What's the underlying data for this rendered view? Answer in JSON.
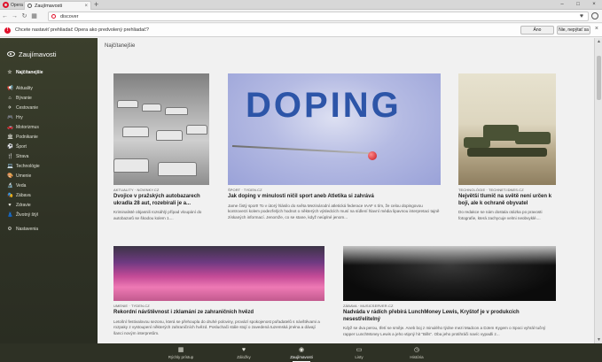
{
  "tabbar": {
    "menu_label": "Opera",
    "tab_title": "Zaujímavosti",
    "tab_close": "×",
    "new_tab": "+",
    "controls": [
      "–",
      "□",
      "×"
    ]
  },
  "addressbar": {
    "back": "←",
    "forward": "→",
    "reload": "↻",
    "speed": "▦",
    "url": "discover",
    "heart": "♥"
  },
  "infobar": {
    "text": "Chcete nastaviť prehliadač Opera ako predvolený prehliadač?",
    "yes_label": "Áno",
    "no_label": "Nie, nepýtať sa",
    "close": "×"
  },
  "sidebar": {
    "title": "Zaujímavosti",
    "items": [
      {
        "icon": "☆",
        "label": "Najčítanejšie"
      },
      {
        "icon": "📢",
        "label": "Aktuality"
      },
      {
        "icon": "⌂",
        "label": "Bývanie"
      },
      {
        "icon": "✈",
        "label": "Cestovanie"
      },
      {
        "icon": "🎮",
        "label": "Hry"
      },
      {
        "icon": "🚗",
        "label": "Motorizmus"
      },
      {
        "icon": "🏛",
        "label": "Podnikanie"
      },
      {
        "icon": "⚽",
        "label": "Šport"
      },
      {
        "icon": "🍴",
        "label": "Strava"
      },
      {
        "icon": "💻",
        "label": "Technológie"
      },
      {
        "icon": "🎨",
        "label": "Umenie"
      },
      {
        "icon": "🔬",
        "label": "Veda"
      },
      {
        "icon": "🎭",
        "label": "Zábava"
      },
      {
        "icon": "♥",
        "label": "Zdravie"
      },
      {
        "icon": "👗",
        "label": "Životný štýl"
      },
      {
        "icon": "⚙",
        "label": "Nastavenia"
      }
    ]
  },
  "main": {
    "title": "Najčítanejšie",
    "cards": [
      {
        "source": "AKTUALITY · NOVINKY.CZ",
        "title": "Dvojice v pražských autobazarech ukradla 28 aut, rozebírali je a...",
        "desc": "Kriminalisté objasnili rozsáhlý případ vloupání do autobazarů se škodou kolem 1...."
      },
      {
        "source": "ŠPORT · TYDEN.CZ",
        "title": "Jak doping v minulosti ničil sport aneb Atletika si zahrává",
        "desc": "Jame čistý sport! To v útorý hlásilo do světa Mezinárodní atletická federace IAAF s tím, že celou dopingovou kontroverzi kolem podezřelých hodnot o některých výsledcích musí na sídlení hlavní média lipavnou interpretaci tajně získaných informací. Jenomže, co se stane, když neúplné jenom...",
        "image_text": "DOPING"
      },
      {
        "source": "TECHNOLÓGIE · TECHNET.IDNES.CZ",
        "title": "Největší tlumič na světě není určen k boji, ale k ochraně obyvatel",
        "desc": "Do redakce se nám dostala otázka po pravosti fotografie, která zachycuje velmi neobvyklé...."
      },
      {
        "source": "UMENIE · TYDEN.CZ",
        "title": "Rekordní návštěvnost i zklamání ze zahraničních hvězd",
        "desc": "Letošní festivalovou sezonu, která se přehoupla do druhé poloviny, provází spokojenost pořadatelů s návštěvami a rozpaky z vystoupení některých zahraničních hvězd. Posluchači stále stojí o zavedená tuzemská jména a dávají šanci novým interpretům."
      },
      {
        "source": "ZÁBAVA · MUSICSERVER.CZ",
        "title": "Nadváda v rádích přebírá LunchMoney Lewis, Kryštof je v produkcích nesestřelitelný",
        "desc": "Když se dva perou, třetí se směje. Aneb boj z minulého týdne mezi Madcon a DJem Kygem o Spoci vyhrál tučný rapper LunchMoney Lewis a jeho vtipný hit \"Bills\". Oba jeho protihráči navíc vypadli z..."
      }
    ]
  },
  "scrollbar": {
    "up": "▲",
    "down": "▼"
  },
  "bottombar": {
    "items": [
      {
        "icon": "▦",
        "label": "Rýchly prístup"
      },
      {
        "icon": "♥",
        "label": "Záložky"
      },
      {
        "icon": "◉",
        "label": "Zaujímavosti"
      },
      {
        "icon": "▭",
        "label": "Listy"
      },
      {
        "icon": "◷",
        "label": "História"
      }
    ]
  }
}
